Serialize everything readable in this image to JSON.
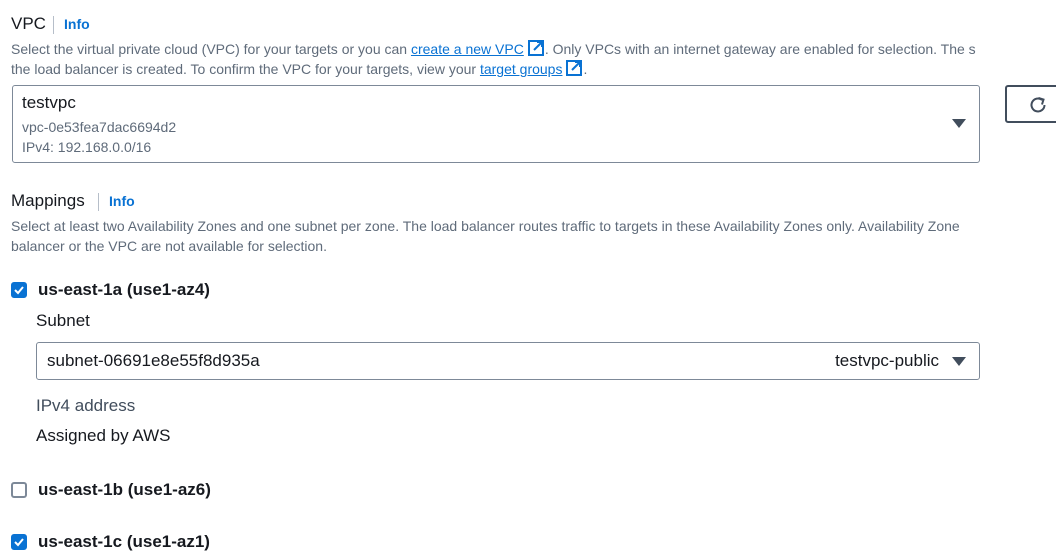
{
  "vpc": {
    "title": "VPC",
    "info": "Info",
    "desc_part1": "Select the virtual private cloud (VPC) for your targets or you can",
    "create_link": "create a new VPC",
    "desc_part2": ". Only VPCs with an internet gateway are enabled for selection. The s",
    "desc_line2_part1": "the load balancer is created. To confirm the VPC for your targets, view your",
    "target_groups_link": "target groups",
    "desc_line2_end": ".",
    "select": {
      "name": "testvpc",
      "id": "vpc-0e53fea7dac6694d2",
      "cidr": "IPv4: 192.168.0.0/16"
    },
    "refresh_icon": "refresh-icon"
  },
  "mappings": {
    "title": "Mappings",
    "info": "Info",
    "desc_line1": "Select at least two Availability Zones and one subnet per zone. The load balancer routes traffic to targets in these Availability Zones only. Availability Zone",
    "desc_line2": "balancer or the VPC are not available for selection.",
    "zones": [
      {
        "label": "us-east-1a (use1-az4)",
        "checked": true,
        "subnet_label": "Subnet",
        "subnet_id": "subnet-06691e8e55f8d935a",
        "subnet_name": "testvpc-public",
        "ipv4_label": "IPv4 address",
        "ipv4_value": "Assigned by AWS"
      },
      {
        "label": "us-east-1b (use1-az6)",
        "checked": false
      },
      {
        "label": "us-east-1c (use1-az1)",
        "checked": true
      }
    ]
  },
  "colors": {
    "accent": "#0972d3",
    "text": "#16191f",
    "muted": "#5f6b7a",
    "border": "#7d8998"
  }
}
